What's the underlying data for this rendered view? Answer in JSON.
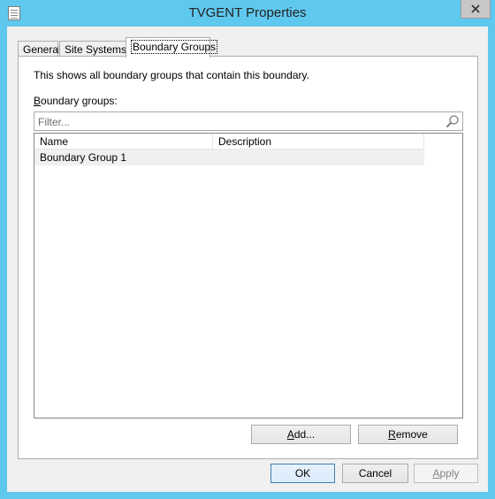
{
  "window": {
    "title": "TVGENT Properties"
  },
  "tabs": [
    {
      "label": "General",
      "selected": false
    },
    {
      "label": "Site Systems",
      "selected": false
    },
    {
      "label": "Boundary Groups",
      "selected": true
    }
  ],
  "panel": {
    "info_text": "This shows all boundary groups that contain this boundary.",
    "groups_label_first": "B",
    "groups_label_rest": "oundary groups:",
    "filter": {
      "placeholder": "Filter...",
      "value": ""
    },
    "columns": [
      "Name",
      "Description"
    ],
    "rows": [
      {
        "name": "Boundary Group 1",
        "description": ""
      }
    ],
    "add_button": {
      "pre": "",
      "ul": "A",
      "post": "dd..."
    },
    "remove_button": {
      "pre": "",
      "ul": "R",
      "post": "emove"
    }
  },
  "footer": {
    "ok_label": "OK",
    "cancel_label": "Cancel",
    "apply_button": {
      "ul": "A",
      "post": "pply",
      "disabled": true
    }
  },
  "icons": {
    "app": "properties-sheet-icon",
    "close": "close-icon",
    "search": "search-icon"
  }
}
